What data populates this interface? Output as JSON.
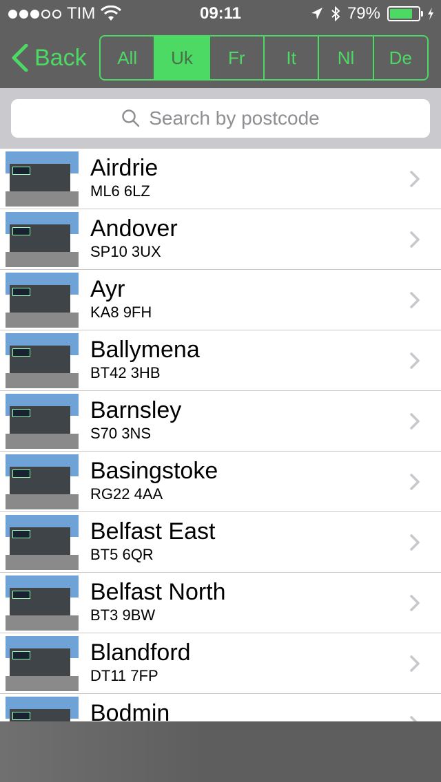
{
  "status_bar": {
    "carrier": "TIM",
    "time": "09:11",
    "battery_percent": "79%",
    "battery_level": 0.79,
    "signal_bars": 3
  },
  "nav": {
    "back_label": "Back",
    "countries": [
      "All",
      "Uk",
      "Fr",
      "It",
      "Nl",
      "De"
    ],
    "selected_country": "Uk"
  },
  "search": {
    "placeholder": "Search by postcode"
  },
  "locations": [
    {
      "name": "Airdrie",
      "postcode": "ML6 6LZ"
    },
    {
      "name": "Andover",
      "postcode": "SP10 3UX"
    },
    {
      "name": "Ayr",
      "postcode": "KA8 9FH"
    },
    {
      "name": "Ballymena",
      "postcode": "BT42 3HB"
    },
    {
      "name": "Barnsley",
      "postcode": "S70 3NS"
    },
    {
      "name": "Basingstoke",
      "postcode": "RG22 4AA"
    },
    {
      "name": "Belfast East",
      "postcode": "BT5 6QR"
    },
    {
      "name": "Belfast North",
      "postcode": "BT3 9BW"
    },
    {
      "name": "Blandford",
      "postcode": "DT11 7FP"
    },
    {
      "name": "Bodmin",
      "postcode": ""
    }
  ],
  "colors": {
    "accent": "#4cd964",
    "header_bg": "#606060",
    "search_bg": "#c9c9ce"
  },
  "icons": {
    "back": "chevron-left-icon",
    "search": "magnifier-icon",
    "row": "chevron-right-icon"
  }
}
